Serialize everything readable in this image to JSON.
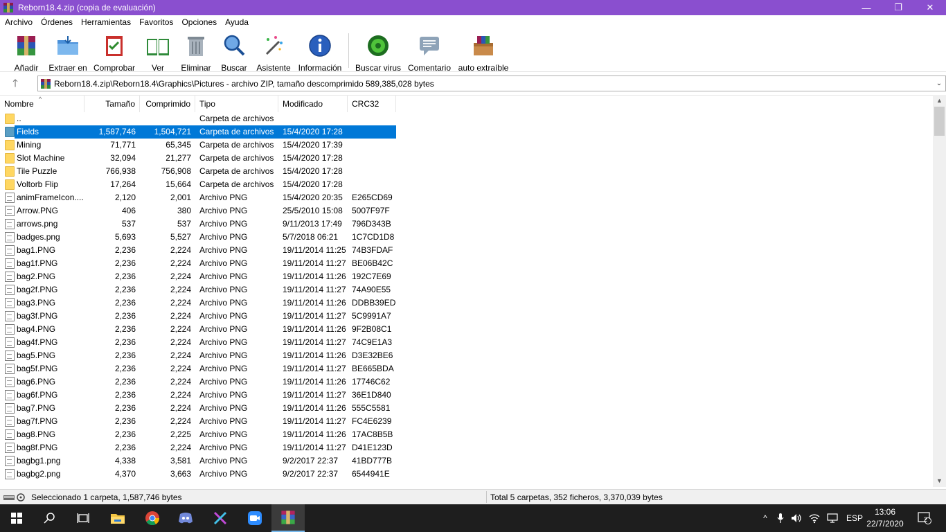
{
  "window": {
    "title": "Reborn18.4.zip (copia de evaluación)",
    "minimize_glyph": "—",
    "maximize_glyph": "❐",
    "close_glyph": "✕"
  },
  "menu": [
    "Archivo",
    "Órdenes",
    "Herramientas",
    "Favoritos",
    "Opciones",
    "Ayuda"
  ],
  "toolbar": {
    "add": "Añadir",
    "extract": "Extraer en",
    "test": "Comprobar",
    "view": "Ver",
    "delete": "Eliminar",
    "find": "Buscar",
    "wizard": "Asistente",
    "info": "Información",
    "virus": "Buscar virus",
    "comment": "Comentario",
    "sfx": "auto extraíble"
  },
  "address": {
    "path": "Reborn18.4.zip\\Reborn18.4\\Graphics\\Pictures - archivo ZIP, tamaño descomprimido 589,385,028 bytes",
    "up_glyph": "🡑",
    "dropdown_glyph": "⌄"
  },
  "columns": {
    "name": "Nombre",
    "size": "Tamaño",
    "compressed": "Comprimido",
    "type": "Tipo",
    "modified": "Modificado",
    "crc": "CRC32"
  },
  "rows": [
    {
      "kind": "folder",
      "name": "..",
      "size": "",
      "compressed": "",
      "type": "Carpeta de archivos",
      "modified": "",
      "crc": ""
    },
    {
      "kind": "folder",
      "name": "Fields",
      "size": "1,587,746",
      "compressed": "1,504,721",
      "type": "Carpeta de archivos",
      "modified": "15/4/2020 17:28",
      "crc": "",
      "selected": true
    },
    {
      "kind": "folder",
      "name": "Mining",
      "size": "71,771",
      "compressed": "65,345",
      "type": "Carpeta de archivos",
      "modified": "15/4/2020 17:39",
      "crc": ""
    },
    {
      "kind": "folder",
      "name": "Slot Machine",
      "size": "32,094",
      "compressed": "21,277",
      "type": "Carpeta de archivos",
      "modified": "15/4/2020 17:28",
      "crc": ""
    },
    {
      "kind": "folder",
      "name": "Tile Puzzle",
      "size": "766,938",
      "compressed": "756,908",
      "type": "Carpeta de archivos",
      "modified": "15/4/2020 17:28",
      "crc": ""
    },
    {
      "kind": "folder",
      "name": "Voltorb Flip",
      "size": "17,264",
      "compressed": "15,664",
      "type": "Carpeta de archivos",
      "modified": "15/4/2020 17:28",
      "crc": ""
    },
    {
      "kind": "file",
      "name": "animFrameIcon....",
      "size": "2,120",
      "compressed": "2,001",
      "type": "Archivo PNG",
      "modified": "15/4/2020 20:35",
      "crc": "E265CD69"
    },
    {
      "kind": "file",
      "name": "Arrow.PNG",
      "size": "406",
      "compressed": "380",
      "type": "Archivo PNG",
      "modified": "25/5/2010 15:08",
      "crc": "5007F97F"
    },
    {
      "kind": "file",
      "name": "arrows.png",
      "size": "537",
      "compressed": "537",
      "type": "Archivo PNG",
      "modified": "9/11/2013 17:49",
      "crc": "796D343B"
    },
    {
      "kind": "file",
      "name": "badges.png",
      "size": "5,693",
      "compressed": "5,527",
      "type": "Archivo PNG",
      "modified": "5/7/2018 06:21",
      "crc": "1C7CD1D8"
    },
    {
      "kind": "file",
      "name": "bag1.PNG",
      "size": "2,236",
      "compressed": "2,224",
      "type": "Archivo PNG",
      "modified": "19/11/2014 11:25",
      "crc": "74B3FDAF"
    },
    {
      "kind": "file",
      "name": "bag1f.PNG",
      "size": "2,236",
      "compressed": "2,224",
      "type": "Archivo PNG",
      "modified": "19/11/2014 11:27",
      "crc": "BE06B42C"
    },
    {
      "kind": "file",
      "name": "bag2.PNG",
      "size": "2,236",
      "compressed": "2,224",
      "type": "Archivo PNG",
      "modified": "19/11/2014 11:26",
      "crc": "192C7E69"
    },
    {
      "kind": "file",
      "name": "bag2f.PNG",
      "size": "2,236",
      "compressed": "2,224",
      "type": "Archivo PNG",
      "modified": "19/11/2014 11:27",
      "crc": "74A90E55"
    },
    {
      "kind": "file",
      "name": "bag3.PNG",
      "size": "2,236",
      "compressed": "2,224",
      "type": "Archivo PNG",
      "modified": "19/11/2014 11:26",
      "crc": "DDBB39ED"
    },
    {
      "kind": "file",
      "name": "bag3f.PNG",
      "size": "2,236",
      "compressed": "2,224",
      "type": "Archivo PNG",
      "modified": "19/11/2014 11:27",
      "crc": "5C9991A7"
    },
    {
      "kind": "file",
      "name": "bag4.PNG",
      "size": "2,236",
      "compressed": "2,224",
      "type": "Archivo PNG",
      "modified": "19/11/2014 11:26",
      "crc": "9F2B08C1"
    },
    {
      "kind": "file",
      "name": "bag4f.PNG",
      "size": "2,236",
      "compressed": "2,224",
      "type": "Archivo PNG",
      "modified": "19/11/2014 11:27",
      "crc": "74C9E1A3"
    },
    {
      "kind": "file",
      "name": "bag5.PNG",
      "size": "2,236",
      "compressed": "2,224",
      "type": "Archivo PNG",
      "modified": "19/11/2014 11:26",
      "crc": "D3E32BE6"
    },
    {
      "kind": "file",
      "name": "bag5f.PNG",
      "size": "2,236",
      "compressed": "2,224",
      "type": "Archivo PNG",
      "modified": "19/11/2014 11:27",
      "crc": "BE665BDA"
    },
    {
      "kind": "file",
      "name": "bag6.PNG",
      "size": "2,236",
      "compressed": "2,224",
      "type": "Archivo PNG",
      "modified": "19/11/2014 11:26",
      "crc": "17746C62"
    },
    {
      "kind": "file",
      "name": "bag6f.PNG",
      "size": "2,236",
      "compressed": "2,224",
      "type": "Archivo PNG",
      "modified": "19/11/2014 11:27",
      "crc": "36E1D840"
    },
    {
      "kind": "file",
      "name": "bag7.PNG",
      "size": "2,236",
      "compressed": "2,224",
      "type": "Archivo PNG",
      "modified": "19/11/2014 11:26",
      "crc": "555C5581"
    },
    {
      "kind": "file",
      "name": "bag7f.PNG",
      "size": "2,236",
      "compressed": "2,224",
      "type": "Archivo PNG",
      "modified": "19/11/2014 11:27",
      "crc": "FC4E6239"
    },
    {
      "kind": "file",
      "name": "bag8.PNG",
      "size": "2,236",
      "compressed": "2,225",
      "type": "Archivo PNG",
      "modified": "19/11/2014 11:26",
      "crc": "17AC8B5B"
    },
    {
      "kind": "file",
      "name": "bag8f.PNG",
      "size": "2,236",
      "compressed": "2,224",
      "type": "Archivo PNG",
      "modified": "19/11/2014 11:27",
      "crc": "D41E123D"
    },
    {
      "kind": "file",
      "name": "bagbg1.png",
      "size": "4,338",
      "compressed": "3,581",
      "type": "Archivo PNG",
      "modified": "9/2/2017 22:37",
      "crc": "41BD777B"
    },
    {
      "kind": "file",
      "name": "bagbg2.png",
      "size": "4,370",
      "compressed": "3,663",
      "type": "Archivo PNG",
      "modified": "9/2/2017 22:37",
      "crc": "6544941E"
    }
  ],
  "status": {
    "left": "Seleccionado 1 carpeta, 1,587,746 bytes",
    "right": "Total 5 carpetas, 352 ficheros, 3,370,039 bytes"
  },
  "taskbar": {
    "language": "ESP",
    "time": "13:06",
    "date": "22/7/2020",
    "notifications": "2"
  },
  "colors": {
    "titlebar": "#8a4fcf",
    "selection": "#0078d7",
    "taskbar": "#1e1e1e"
  }
}
